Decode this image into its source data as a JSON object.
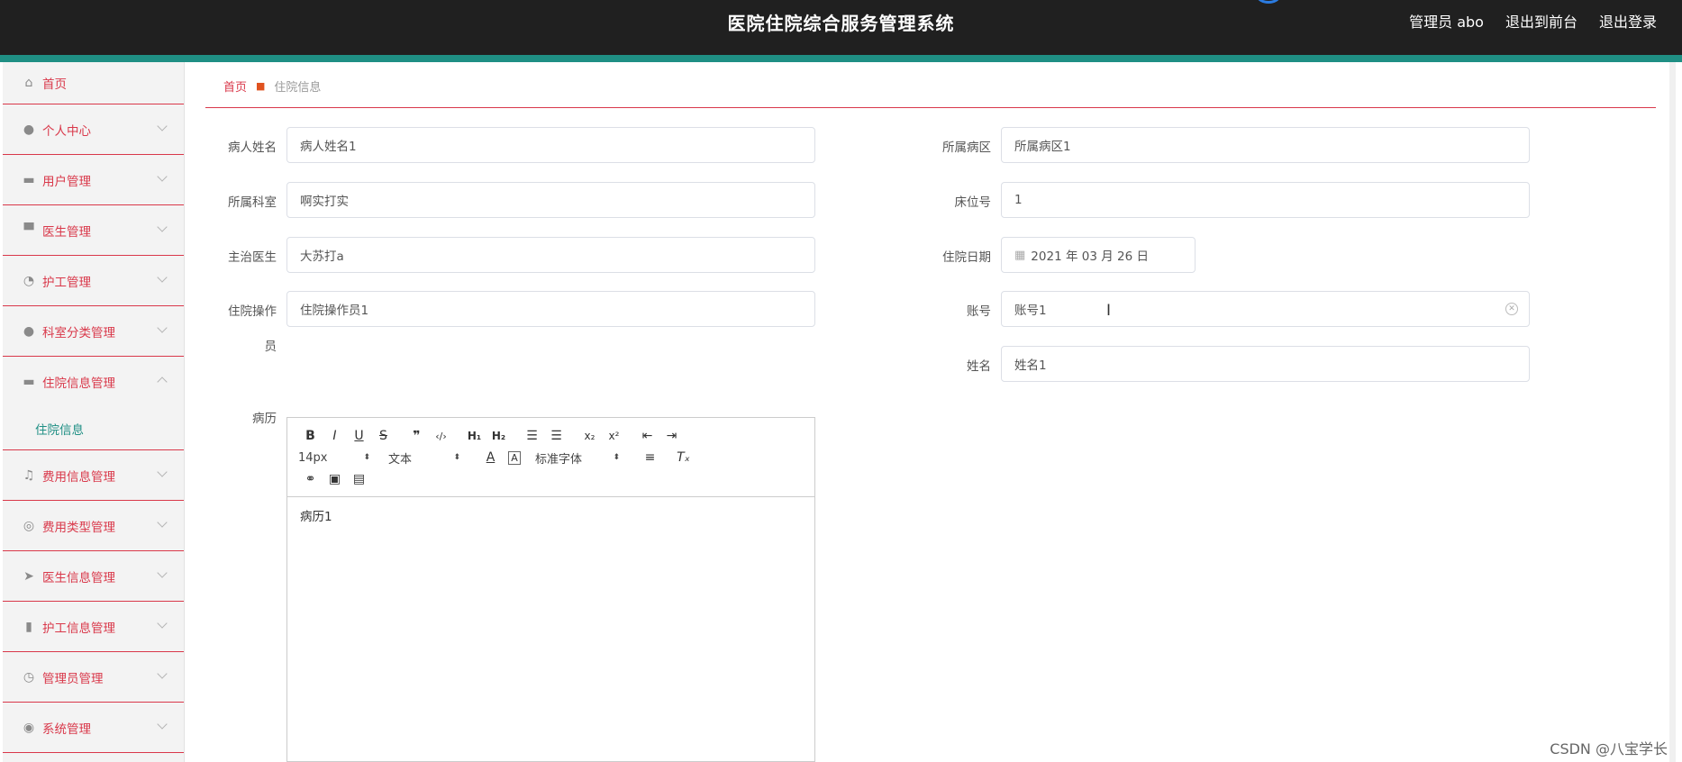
{
  "app": {
    "title": "医院住院综合服务管理系统",
    "nav": [
      "管理员 abo",
      "退出到前台",
      "退出登录"
    ]
  },
  "sidebar": {
    "items": [
      {
        "label": "首页",
        "icon": "home-icon",
        "first": true
      },
      {
        "label": "个人中心",
        "icon": "user-icon"
      },
      {
        "label": "用户管理",
        "icon": "ticket-icon"
      },
      {
        "label": "医生管理",
        "icon": "monitor-icon"
      },
      {
        "label": "护工管理",
        "icon": "gauge-icon"
      },
      {
        "label": "科室分类管理",
        "icon": "person-icon"
      },
      {
        "label": "住院信息管理",
        "icon": "chat-icon",
        "expanded": true
      },
      {
        "label": "费用信息管理",
        "icon": "mic-icon"
      },
      {
        "label": "费用类型管理",
        "icon": "aperture-icon"
      },
      {
        "label": "医生信息管理",
        "icon": "send-icon"
      },
      {
        "label": "护工信息管理",
        "icon": "bar-chart-icon"
      },
      {
        "label": "管理员管理",
        "icon": "clock-icon"
      },
      {
        "label": "系统管理",
        "icon": "target-icon"
      }
    ],
    "sub_item": "住院信息"
  },
  "breadcrumb": {
    "home": "首页",
    "current": "住院信息"
  },
  "form": {
    "patient_name": {
      "label": "病人姓名",
      "value": "病人姓名1"
    },
    "ward": {
      "label": "所属病区",
      "value": "所属病区1"
    },
    "department": {
      "label": "所属科室",
      "value": "啊实打实"
    },
    "bed": {
      "label": "床位号",
      "value": "1"
    },
    "doctor": {
      "label": "主治医生",
      "value": "大苏打a"
    },
    "date": {
      "label": "住院日期",
      "value": "2021 年 03 月 26 日"
    },
    "operator": {
      "label_line1": "住院操作",
      "label_line2": "员",
      "value": "住院操作员1"
    },
    "account": {
      "label": "账号",
      "value": "账号1"
    },
    "name": {
      "label": "姓名",
      "value": "姓名1"
    },
    "record": {
      "label": "病历",
      "value": "病历1"
    }
  },
  "editor": {
    "size_picker": "14px",
    "format_picker": "文本",
    "font_picker": "标准字体"
  },
  "watermark": "CSDN @八宝学长"
}
